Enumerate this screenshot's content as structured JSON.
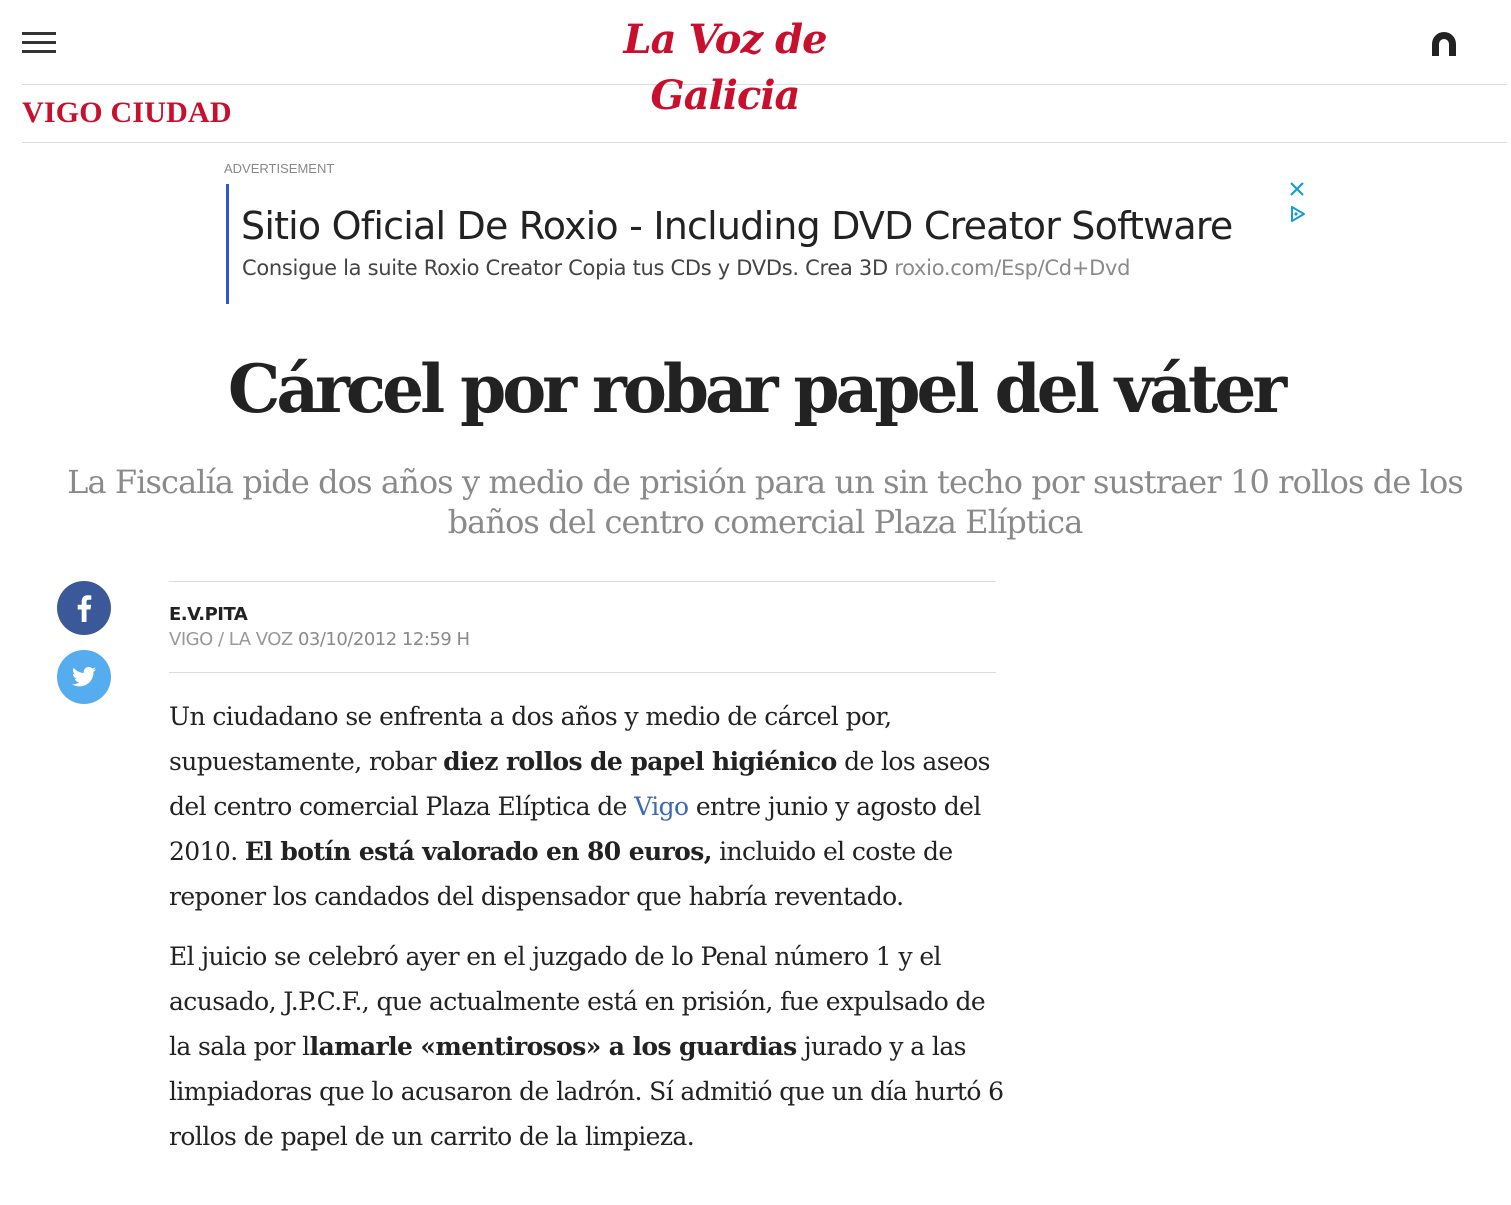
{
  "header": {
    "logo_text": "La Voz de Galicia",
    "menu_icon": "hamburger-menu-icon",
    "user_icon": "user-account-icon"
  },
  "section": {
    "title": "VIGO CIUDAD"
  },
  "ad": {
    "label": "ADVERTISEMENT",
    "title": "Sitio Oficial De Roxio - Including DVD Creator Software",
    "description": "Consigue la suite Roxio Creator Copia tus CDs y DVDs. Crea 3D",
    "url": "roxio.com/Esp/Cd+Dvd",
    "close_icon": "close-icon",
    "adchoices_icon": "adchoices-icon",
    "accent_color": "#2d57d8"
  },
  "article": {
    "headline": "Cárcel por robar papel del váter",
    "subtitle": "La Fiscalía pide dos años y medio de prisión para un sin techo por sustraer 10 rollos de los baños del centro comercial Plaza Elíptica",
    "author": "E.V.PITA",
    "location": "VIGO / LA VOZ",
    "date": "03/10/2012 12:59 H",
    "paragraphs": [
      [
        {
          "t": "Un ciudadano se enfrenta a dos años y medio de cárcel por, supuestamente, robar "
        },
        {
          "t": "diez rollos de papel higiénico",
          "b": true
        },
        {
          "t": " de los aseos del centro comercial Plaza Elíptica de "
        },
        {
          "t": "Vigo",
          "link": true
        },
        {
          "t": " entre junio y agosto del 2010. "
        },
        {
          "t": "El botín está valorado en 80 euros,",
          "b": true
        },
        {
          "t": " incluido el coste de reponer los candados del dispensador que habría reventado."
        }
      ],
      [
        {
          "t": "El juicio se celebró ayer en el juzgado de lo Penal número 1 y el acusado, J.P.C.F., que actualmente está en prisión, fue expulsado de la sala por l"
        },
        {
          "t": "lamarle «mentirosos» a los guardias",
          "b": true
        },
        {
          "t": " jurado y a las limpiadoras que lo acusaron de ladrón. Sí admitió que un día hurtó 6 rollos de papel de un carrito de la limpieza."
        }
      ]
    ]
  },
  "share": {
    "facebook_icon": "facebook-icon",
    "twitter_icon": "twitter-icon"
  },
  "colors": {
    "brand": "#c8102e",
    "facebook": "#3b5998",
    "twitter": "#55acee",
    "link": "#3e6ab0"
  }
}
